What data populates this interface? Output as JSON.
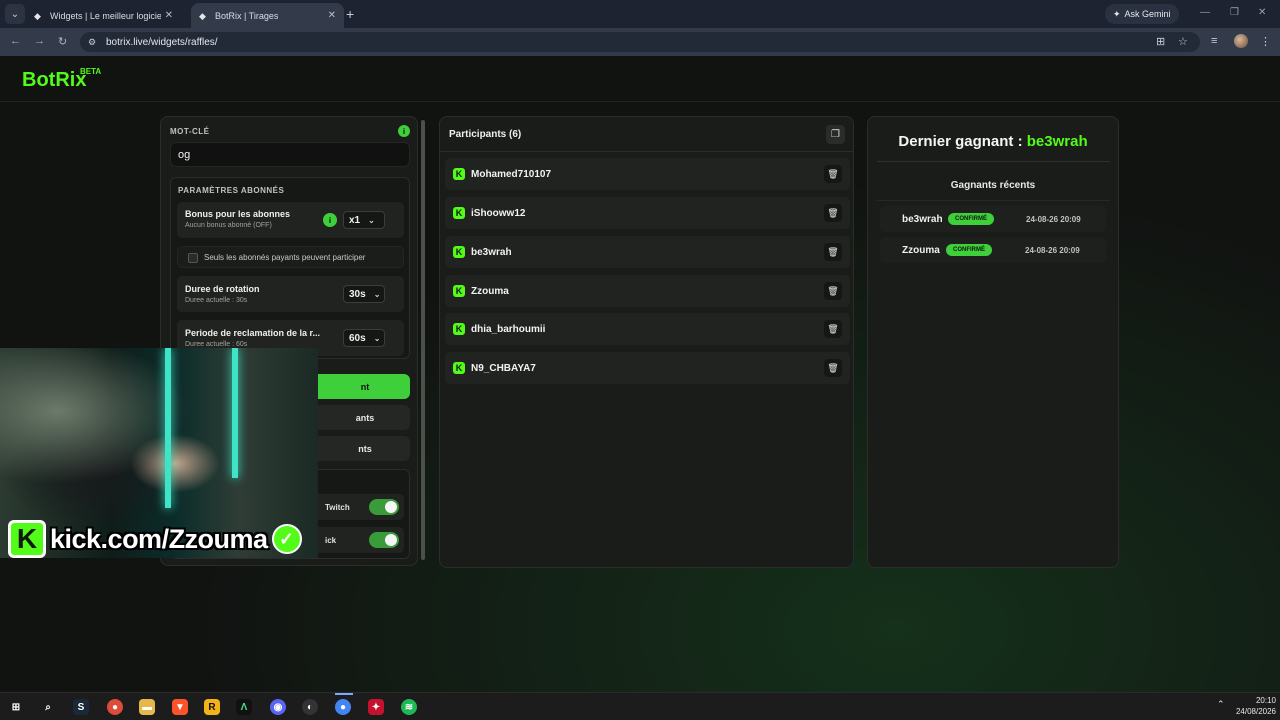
{
  "browser": {
    "tabs": [
      {
        "title": "Widgets | Le meilleur logiciel p"
      },
      {
        "title": "BotRix | Tirages"
      }
    ],
    "url": "botrix.live/widgets/raffles/",
    "ask_gemini": "Ask Gemini"
  },
  "app": {
    "logo": "BotRix",
    "beta": "BETA"
  },
  "settings": {
    "keyword_label": "MOT-CLÉ",
    "keyword_value": "og",
    "subscriber_section": "PARAMÈTRES ABONNÉS",
    "bonus_title": "Bonus pour les abonnes",
    "bonus_sub": "Aucun bonus abonné (OFF)",
    "bonus_value": "x1",
    "paid_only_label": "Seuls les abonnés payants peuvent participer",
    "rotation_title": "Duree de rotation",
    "rotation_sub": "Duree actuelle : 30s",
    "rotation_value": "30s",
    "claim_title": "Periode de reclamation de la r...",
    "claim_sub": "Duree actuelle : 60s",
    "claim_value": "60s",
    "button1": "nt",
    "button2": "ants",
    "button3": "nts",
    "toggle1_label": "Twitch",
    "toggle2_label": "ick"
  },
  "participants": {
    "title": "Participants (6)",
    "list": [
      "Mohamed710107",
      "iShooww12",
      "be3wrah",
      "Zzouma",
      "dhia_barhoumii",
      "N9_CHBAYA7"
    ]
  },
  "winners": {
    "last_label": "Dernier gagnant :",
    "last_name": "be3wrah",
    "recent_title": "Gagnants récents",
    "recent": [
      {
        "name": "be3wrah",
        "status": "CONFIRMÉ",
        "date": "24-08-26 20:09"
      },
      {
        "name": "Zzouma",
        "status": "CONFIRMÉ",
        "date": "24-08-26 20:09"
      }
    ]
  },
  "overlay": {
    "kick_url": "kick.com/Zzouma"
  },
  "taskbar": {
    "time": "20:10",
    "date": "24/08/2026"
  },
  "colors": {
    "accent": "#53fc18",
    "button_green": "#3ecf3a",
    "background": "#111311"
  }
}
